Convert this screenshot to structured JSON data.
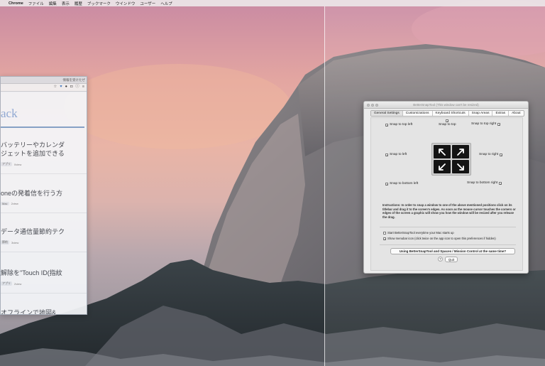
{
  "menubar": {
    "apple": "",
    "app_name": "Chrome",
    "items": [
      "ファイル",
      "編集",
      "表示",
      "履歴",
      "ブックマーク",
      "ウインドウ",
      "ユーザー",
      "ヘルプ"
    ]
  },
  "chrome_window": {
    "tab_label": "情報を受けたぜ",
    "toolbar_icons": [
      "☆",
      "♥",
      "●",
      "◘",
      "ⓘ",
      "≡"
    ],
    "site_logo": "ack",
    "articles": [
      {
        "title_lines": [
          "バッテリーやカレンダ",
          "ジェットを追加できる"
        ],
        "tags": [
          "アプリ"
        ],
        "views": "0view"
      },
      {
        "title_lines": [
          "oneの発着信を行う方"
        ],
        "tags": [
          "Mac"
        ],
        "views": "2view"
      },
      {
        "title_lines": [
          "データ通信量節約テク"
        ],
        "tags": [
          "節約"
        ],
        "views": "3view"
      },
      {
        "title_lines": [
          "解除を\"Touch ID(指紋"
        ],
        "tags": [
          "アプリ"
        ],
        "views": "2view"
      },
      {
        "title_lines": [
          "オフラインで地図&"
        ],
        "tags": [],
        "views": ""
      }
    ]
  },
  "bettersnaptool": {
    "title": "BetterSnapTool (This window can't be resized)",
    "tabs": [
      "General Settings",
      "Customizations",
      "Keyboard Shortcuts",
      "Snap Areas",
      "Extras",
      "About"
    ],
    "active_tab": 0,
    "check_mark": "✓",
    "snap_options": {
      "top_left": "Snap to top left",
      "top": "Snap to top",
      "top_right": "Snap to top right",
      "left": "Snap to left",
      "right": "Snap to right",
      "bottom_left": "Snap to bottom left",
      "bottom_right": "Snap to bottom right"
    },
    "instructions": "Instructions: In order to snap a window to one of the above mentioned positions click on its titlebar and drag it to the screen's edges. As soon as the mouse cursor touches the corners or edges of the screen a graphic will show you how the window will be resized after you release the drag.",
    "start_at_login": "Start BetterSnapTool everytime your Mac starts up",
    "show_menubar_icon": "Show menubar icon (click twice on the app icon to open this preferences if hidden)",
    "spaces_button": "Using BetterSnapTool and Spaces / Mission Control at the same time?",
    "help_button": "?",
    "quit_button": "Quit"
  }
}
